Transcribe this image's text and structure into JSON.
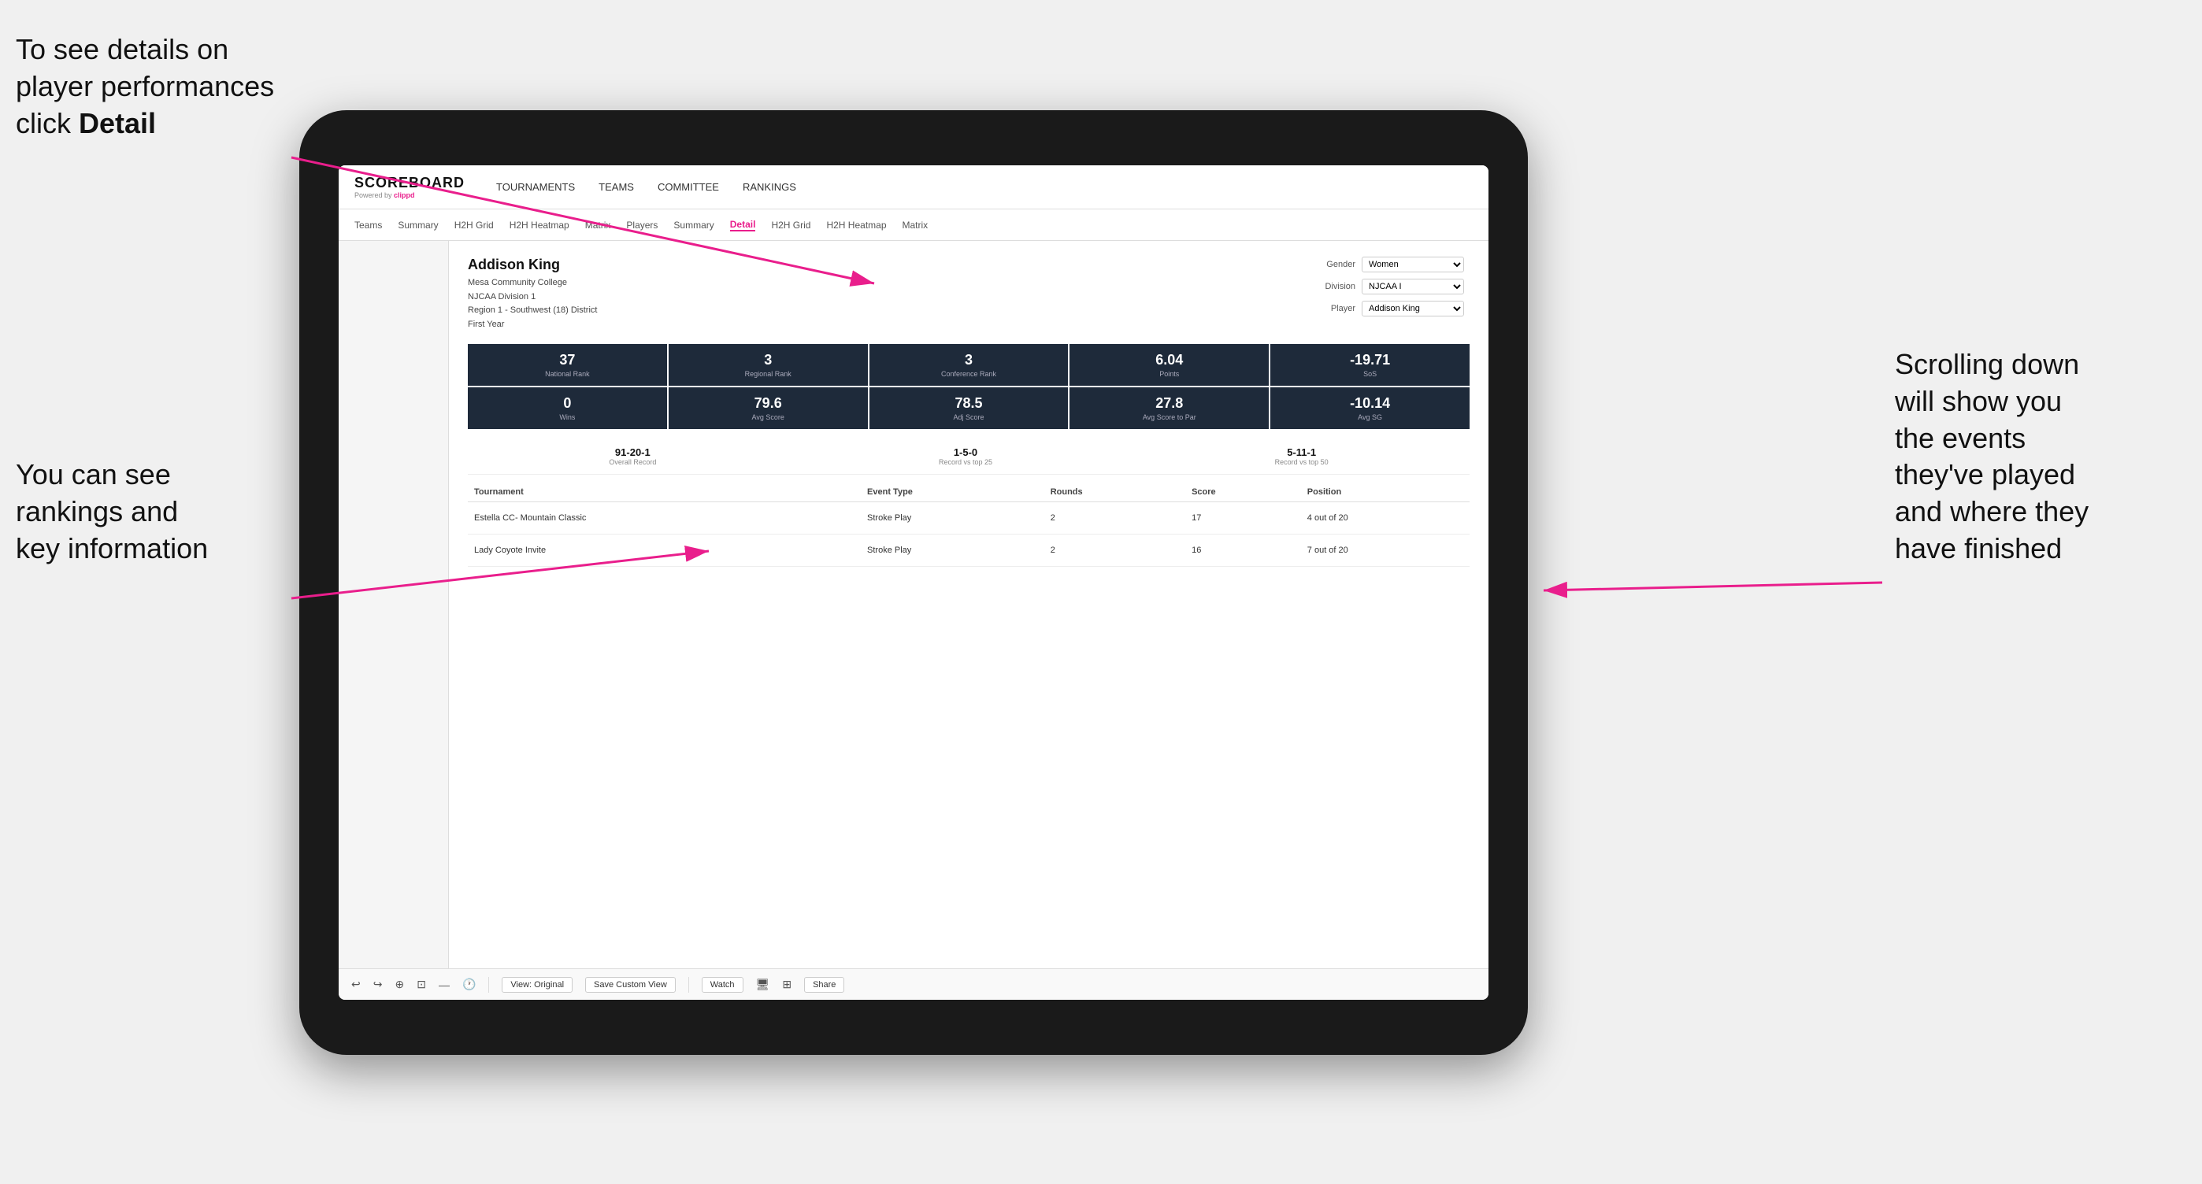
{
  "annotations": {
    "topleft": {
      "line1": "To see details on",
      "line2": "player performances",
      "line3_plain": "click ",
      "line3_bold": "Detail"
    },
    "bottomleft": {
      "line1": "You can see",
      "line2": "rankings and",
      "line3": "key information"
    },
    "right": {
      "line1": "Scrolling down",
      "line2": "will show you",
      "line3": "the events",
      "line4": "they've played",
      "line5": "and where they",
      "line6": "have finished"
    }
  },
  "top_nav": {
    "logo": "SCOREBOARD",
    "powered_by": "Powered by clippd",
    "items": [
      {
        "label": "TOURNAMENTS",
        "active": false
      },
      {
        "label": "TEAMS",
        "active": false
      },
      {
        "label": "COMMITTEE",
        "active": false
      },
      {
        "label": "RANKINGS",
        "active": false
      }
    ]
  },
  "sub_nav": {
    "items": [
      {
        "label": "Teams",
        "active": false
      },
      {
        "label": "Summary",
        "active": false
      },
      {
        "label": "H2H Grid",
        "active": false
      },
      {
        "label": "H2H Heatmap",
        "active": false
      },
      {
        "label": "Matrix",
        "active": false
      },
      {
        "label": "Players",
        "active": false
      },
      {
        "label": "Summary",
        "active": false
      },
      {
        "label": "Detail",
        "active": true
      },
      {
        "label": "H2H Grid",
        "active": false
      },
      {
        "label": "H2H Heatmap",
        "active": false
      },
      {
        "label": "Matrix",
        "active": false
      }
    ]
  },
  "player": {
    "name": "Addison King",
    "school": "Mesa Community College",
    "division": "NJCAA Division 1",
    "region": "Region 1 - Southwest (18) District",
    "year": "First Year"
  },
  "controls": {
    "gender_label": "Gender",
    "gender_value": "Women",
    "division_label": "Division",
    "division_value": "NJCAA I",
    "player_label": "Player",
    "player_value": "Addison King"
  },
  "stats_row1": [
    {
      "value": "37",
      "label": "National Rank"
    },
    {
      "value": "3",
      "label": "Regional Rank"
    },
    {
      "value": "3",
      "label": "Conference Rank"
    },
    {
      "value": "6.04",
      "label": "Points"
    },
    {
      "value": "-19.71",
      "label": "SoS"
    }
  ],
  "stats_row2": [
    {
      "value": "0",
      "label": "Wins"
    },
    {
      "value": "79.6",
      "label": "Avg Score"
    },
    {
      "value": "78.5",
      "label": "Adj Score"
    },
    {
      "value": "27.8",
      "label": "Avg Score to Par"
    },
    {
      "value": "-10.14",
      "label": "Avg SG"
    }
  ],
  "records": [
    {
      "value": "91-20-1",
      "label": "Overall Record"
    },
    {
      "value": "1-5-0",
      "label": "Record vs top 25"
    },
    {
      "value": "5-11-1",
      "label": "Record vs top 50"
    }
  ],
  "table": {
    "columns": [
      "Tournament",
      "Event Type",
      "Rounds",
      "Score",
      "Position"
    ],
    "rows": [
      {
        "tournament": "Estella CC- Mountain Classic",
        "event_type": "Stroke Play",
        "rounds": "2",
        "score": "17",
        "position": "4 out of 20"
      },
      {
        "tournament": "Lady Coyote Invite",
        "event_type": "Stroke Play",
        "rounds": "2",
        "score": "16",
        "position": "7 out of 20"
      }
    ]
  },
  "toolbar": {
    "view_label": "View: Original",
    "save_label": "Save Custom View",
    "watch_label": "Watch",
    "share_label": "Share"
  }
}
